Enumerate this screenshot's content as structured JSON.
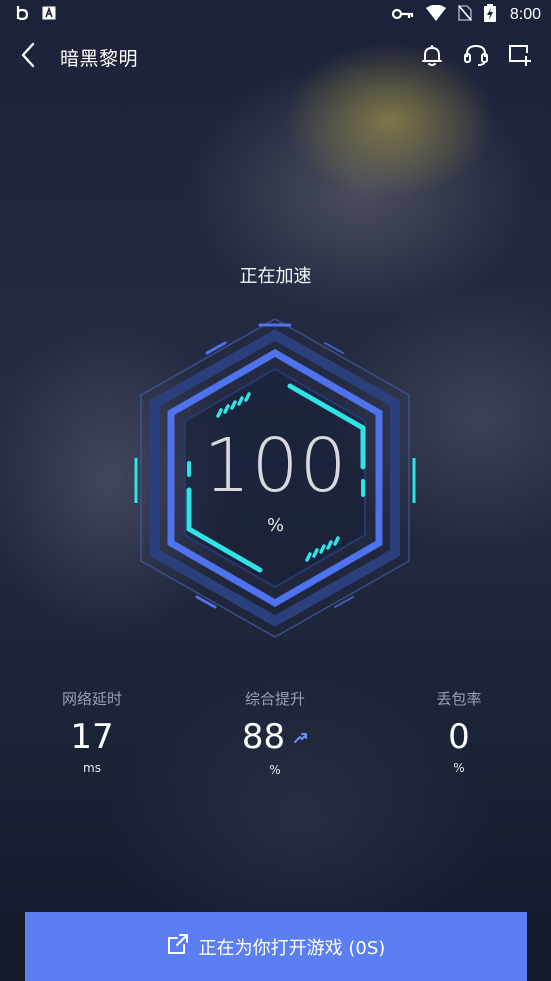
{
  "status_bar": {
    "time": "8:00",
    "left_icons": [
      "b-app-icon",
      "font-app-icon"
    ],
    "right_icons": [
      "vpn-key-icon",
      "wifi-icon",
      "no-sim-icon",
      "battery-charging-icon"
    ]
  },
  "header": {
    "title": "暗黑黎明",
    "icons": [
      "back-chevron-icon",
      "bell-icon",
      "headset-icon",
      "add-window-icon"
    ]
  },
  "accel": {
    "status_text": "正在加速",
    "value": "100",
    "unit": "%",
    "progress_fraction": 1.0
  },
  "stats": [
    {
      "label": "网络延时",
      "value": "17",
      "unit": "ms"
    },
    {
      "label": "综合提升",
      "value": "88",
      "unit": "%",
      "trend": "up"
    },
    {
      "label": "丢包率",
      "value": "0",
      "unit": "%"
    }
  ],
  "cta": {
    "label": "正在为你打开游戏 (0S)",
    "icon": "open-external-icon"
  },
  "colors": {
    "accent": "#5b7ff3",
    "cyan": "#2fe3e6",
    "hex_blue": "#4f73ee",
    "hex_dark": "#2b3f7c",
    "background": "#1c2239"
  }
}
